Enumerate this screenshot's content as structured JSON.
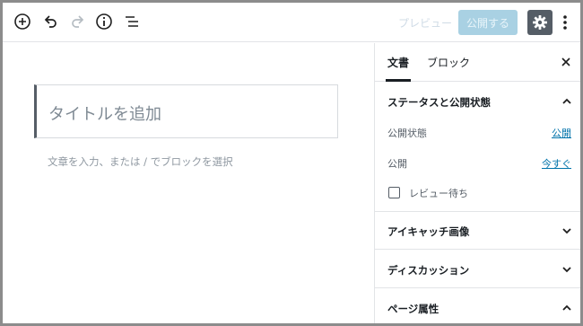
{
  "toolbar": {
    "icons": [
      "add-block-icon",
      "undo-icon",
      "redo-icon",
      "info-icon",
      "block-navigation-icon"
    ],
    "preview_label": "プレビュー",
    "publish_label": "公開する",
    "settings_icon": "gear-icon",
    "more_icon": "more-vertical-icon"
  },
  "editor": {
    "title_placeholder": "タイトルを追加",
    "block_hint": "文章を入力、または / でブロックを選択"
  },
  "sidebar": {
    "tabs": [
      {
        "label": "文書",
        "active": true
      },
      {
        "label": "ブロック",
        "active": false
      }
    ],
    "status_panel": {
      "title": "ステータスと公開状態",
      "expanded": true,
      "visibility_label": "公開状態",
      "visibility_value": "公開",
      "publish_label": "公開",
      "publish_value": "今すぐ",
      "pending_review_label": "レビュー待ち",
      "pending_review_checked": false
    },
    "panels": [
      {
        "title": "アイキャッチ画像",
        "expanded": false
      },
      {
        "title": "ディスカッション",
        "expanded": false
      },
      {
        "title": "ページ属性",
        "expanded": true
      }
    ]
  },
  "colors": {
    "accent_link": "#0073aa",
    "publish_button": "#a9d1e3",
    "settings_button": "#555d66",
    "frame_border": "#8c8c8c"
  }
}
